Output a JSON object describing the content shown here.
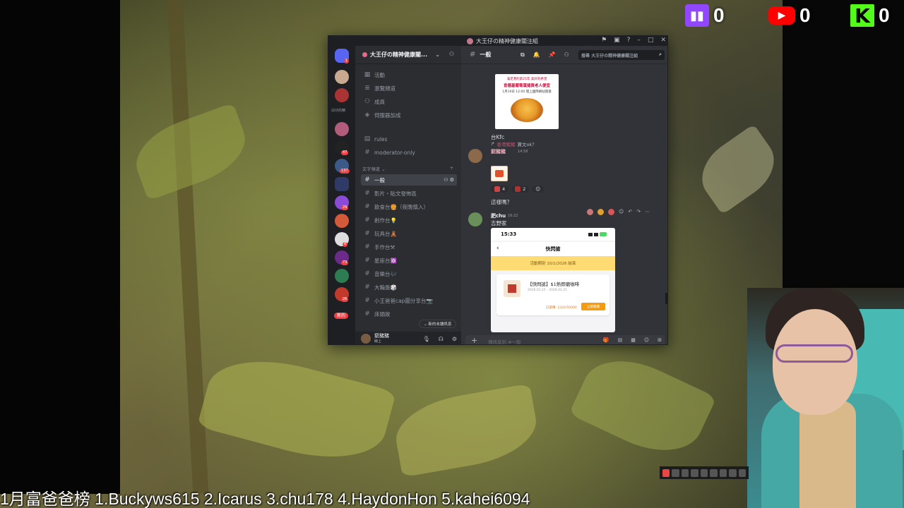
{
  "counters": {
    "twitch": {
      "logo": "twitch-logo",
      "count": "0",
      "color": "#9146ff"
    },
    "youtube": {
      "logo": "youtube-logo",
      "count": "0",
      "color": "#ff0000"
    },
    "kick": {
      "logo": "K",
      "count": "0",
      "color": "#53fc18"
    }
  },
  "ticker": {
    "text": "1月富爸爸榜  1.Buckyws615  2.Icarus  3.chu178  4.HaydonHon  5.kahei6094"
  },
  "discord": {
    "window_title": "大王仔の精神健康關注組",
    "server_name": "大王仔の精神健康關...",
    "nav": [
      {
        "icon": "calendar-icon",
        "label": "活動"
      },
      {
        "icon": "browse-channels-icon",
        "label": "瀏覽頻道"
      },
      {
        "icon": "members-icon",
        "label": "成員"
      },
      {
        "icon": "boost-icon",
        "label": "伺服器加成"
      }
    ],
    "channels_top": [
      {
        "icon": "rules-icon",
        "label": "rules"
      },
      {
        "icon": "hash-icon",
        "label": "moderator-only"
      }
    ],
    "category_label": "文字頻道",
    "channels": [
      {
        "label": "一般",
        "active": true
      },
      {
        "label": "影片・貼文發佈區",
        "active": false
      },
      {
        "label": "飲食台🍔（夜晚慎入）",
        "active": false
      },
      {
        "label": "創作台💡",
        "active": false
      },
      {
        "label": "玩具台🧸",
        "active": false
      },
      {
        "label": "手作台⚒",
        "active": false
      },
      {
        "label": "星座台🔯",
        "active": false
      },
      {
        "label": "音樂台🎶",
        "active": false
      },
      {
        "label": "大輪盤🎲",
        "active": false
      },
      {
        "label": "小王爸爸cap圖分享台📷",
        "active": false
      },
      {
        "label": "床頭故",
        "active": false
      }
    ],
    "rail": {
      "side_label": "白仔的精",
      "new_label": "新的",
      "badges": [
        "47",
        "137",
        "29",
        "8",
        "73",
        "26"
      ],
      "top_badge": "1"
    },
    "new_messages_pill": "新的未讀訊息",
    "user": {
      "name": "窮豬豬",
      "status": "線上"
    },
    "channel_header": "一般",
    "search_placeholder": "搜尋 大王仔の精神健康關注組",
    "promo": {
      "line1": "滿足港的第25年 美好的希望",
      "line2": "肯德基葡萄蛋撻買老人便宜",
      "line3": "1月19日 12:00 開上國際網站開搶"
    },
    "msg_kfc": "台Kfc",
    "reply_preview": {
      "name": "香港豬豬",
      "text": "寶文ok？"
    },
    "msg1": {
      "user": "窮豬豬",
      "time": "14:58",
      "text": "這樣嗎？"
    },
    "reactions": [
      {
        "emoji": "sticker",
        "count": "4"
      },
      {
        "emoji": "flag",
        "count": "2"
      }
    ],
    "msg2": {
      "user": "肥chu",
      "time": "16:22",
      "text": "吉野家"
    },
    "phone": {
      "time": "15:33",
      "nav_title": "快閃搶",
      "band": "活動期別 10/1/2026 結束",
      "item_title": "【快閃搶】$1熱即磨咖啡",
      "item_date": "2026.01.15 - 2026.01.21",
      "progress": "已搶購: 2324/50000",
      "button": "立即搶購"
    },
    "composer_placeholder": "傳訊息到 #一般"
  }
}
